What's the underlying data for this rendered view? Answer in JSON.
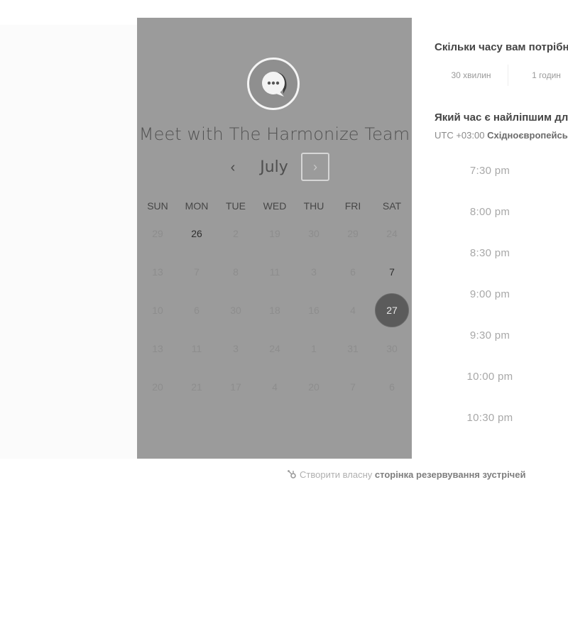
{
  "calendar": {
    "title": "Meet with The Harmonize Team",
    "month": "July",
    "prev_symbol": "‹",
    "next_symbol": "›",
    "weekdays": [
      "SUN",
      "MON",
      "TUE",
      "WED",
      "THU",
      "FRI",
      "SAT"
    ],
    "weeks": [
      [
        "29",
        "26",
        "2",
        "19",
        "30",
        "29",
        "24"
      ],
      [
        "13",
        "7",
        "8",
        "11",
        "3",
        "6",
        "7"
      ],
      [
        "10",
        "6",
        "30",
        "18",
        "16",
        "4",
        "27"
      ],
      [
        "13",
        "11",
        "3",
        "24",
        "1",
        "31",
        "30"
      ],
      [
        "20",
        "21",
        "17",
        "4",
        "20",
        "7",
        "6"
      ]
    ],
    "available_days": [
      "26",
      "7"
    ],
    "selected_day": "27"
  },
  "booking": {
    "duration_question": "Скільки часу вам потрібно?",
    "durations": [
      "30 хвилин",
      "1 годин"
    ],
    "time_question": "Який час є найліпшим для вас?",
    "timezone_offset": "UTC +03:00",
    "timezone_name": "Східноєвропейський час",
    "slots": [
      "7:30 pm",
      "8:00 pm",
      "8:30 pm",
      "9:00 pm",
      "9:30 pm",
      "10:00 pm",
      "10:30 pm"
    ]
  },
  "footer": {
    "prefix": "Створити власну",
    "link": "сторінка резервування зустрічей"
  },
  "colors": {
    "panel": "#9b9b9b",
    "selected_day": "#5b5b5b"
  }
}
